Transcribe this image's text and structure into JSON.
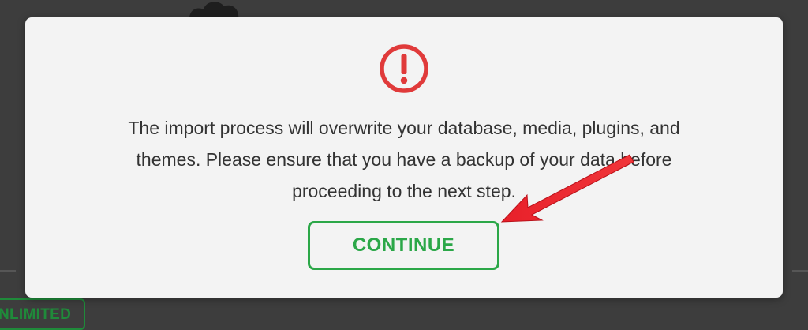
{
  "background": {
    "badge_text": "NLIMITED"
  },
  "modal": {
    "icon": "exclamation-circle-icon",
    "message_line1": "The import process will overwrite your database, media, plugins, and",
    "message_line2": "themes. Please ensure that you have a backup of your data before",
    "message_line3": "proceeding to the next step.",
    "continue_label": "CONTINUE"
  },
  "colors": {
    "backdrop": "#3d3d3d",
    "modal_bg": "#f3f3f3",
    "alert_red": "#e03a3a",
    "continue_green": "#2ba748",
    "arrow_red": "#e8202a"
  }
}
